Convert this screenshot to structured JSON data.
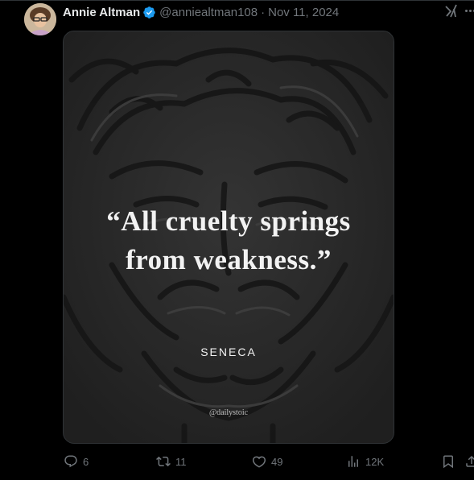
{
  "tweet": {
    "author_name": "Annie Altman",
    "handle": "@anniealtman108",
    "separator": "·",
    "date": "Nov 11, 2024"
  },
  "media": {
    "quote": "“All cruelty springs from weakness.”",
    "quote_line1": "“All cruelty springs",
    "quote_line2": "from weakness.”",
    "author": "SENECA",
    "credit": "@dailystoic"
  },
  "actions": {
    "replies": "6",
    "reposts": "11",
    "likes": "49",
    "views": "12K"
  },
  "icons": {
    "verified": "verified-badge-icon",
    "grok": "grok-icon",
    "more": "more-icon",
    "reply": "reply-icon",
    "repost": "repost-icon",
    "like": "like-icon",
    "views": "views-icon",
    "bookmark": "bookmark-icon",
    "share": "share-icon"
  },
  "colors": {
    "background": "#000000",
    "text": "#e7e9ea",
    "muted": "#71767b",
    "verified": "#1d9bf0"
  }
}
